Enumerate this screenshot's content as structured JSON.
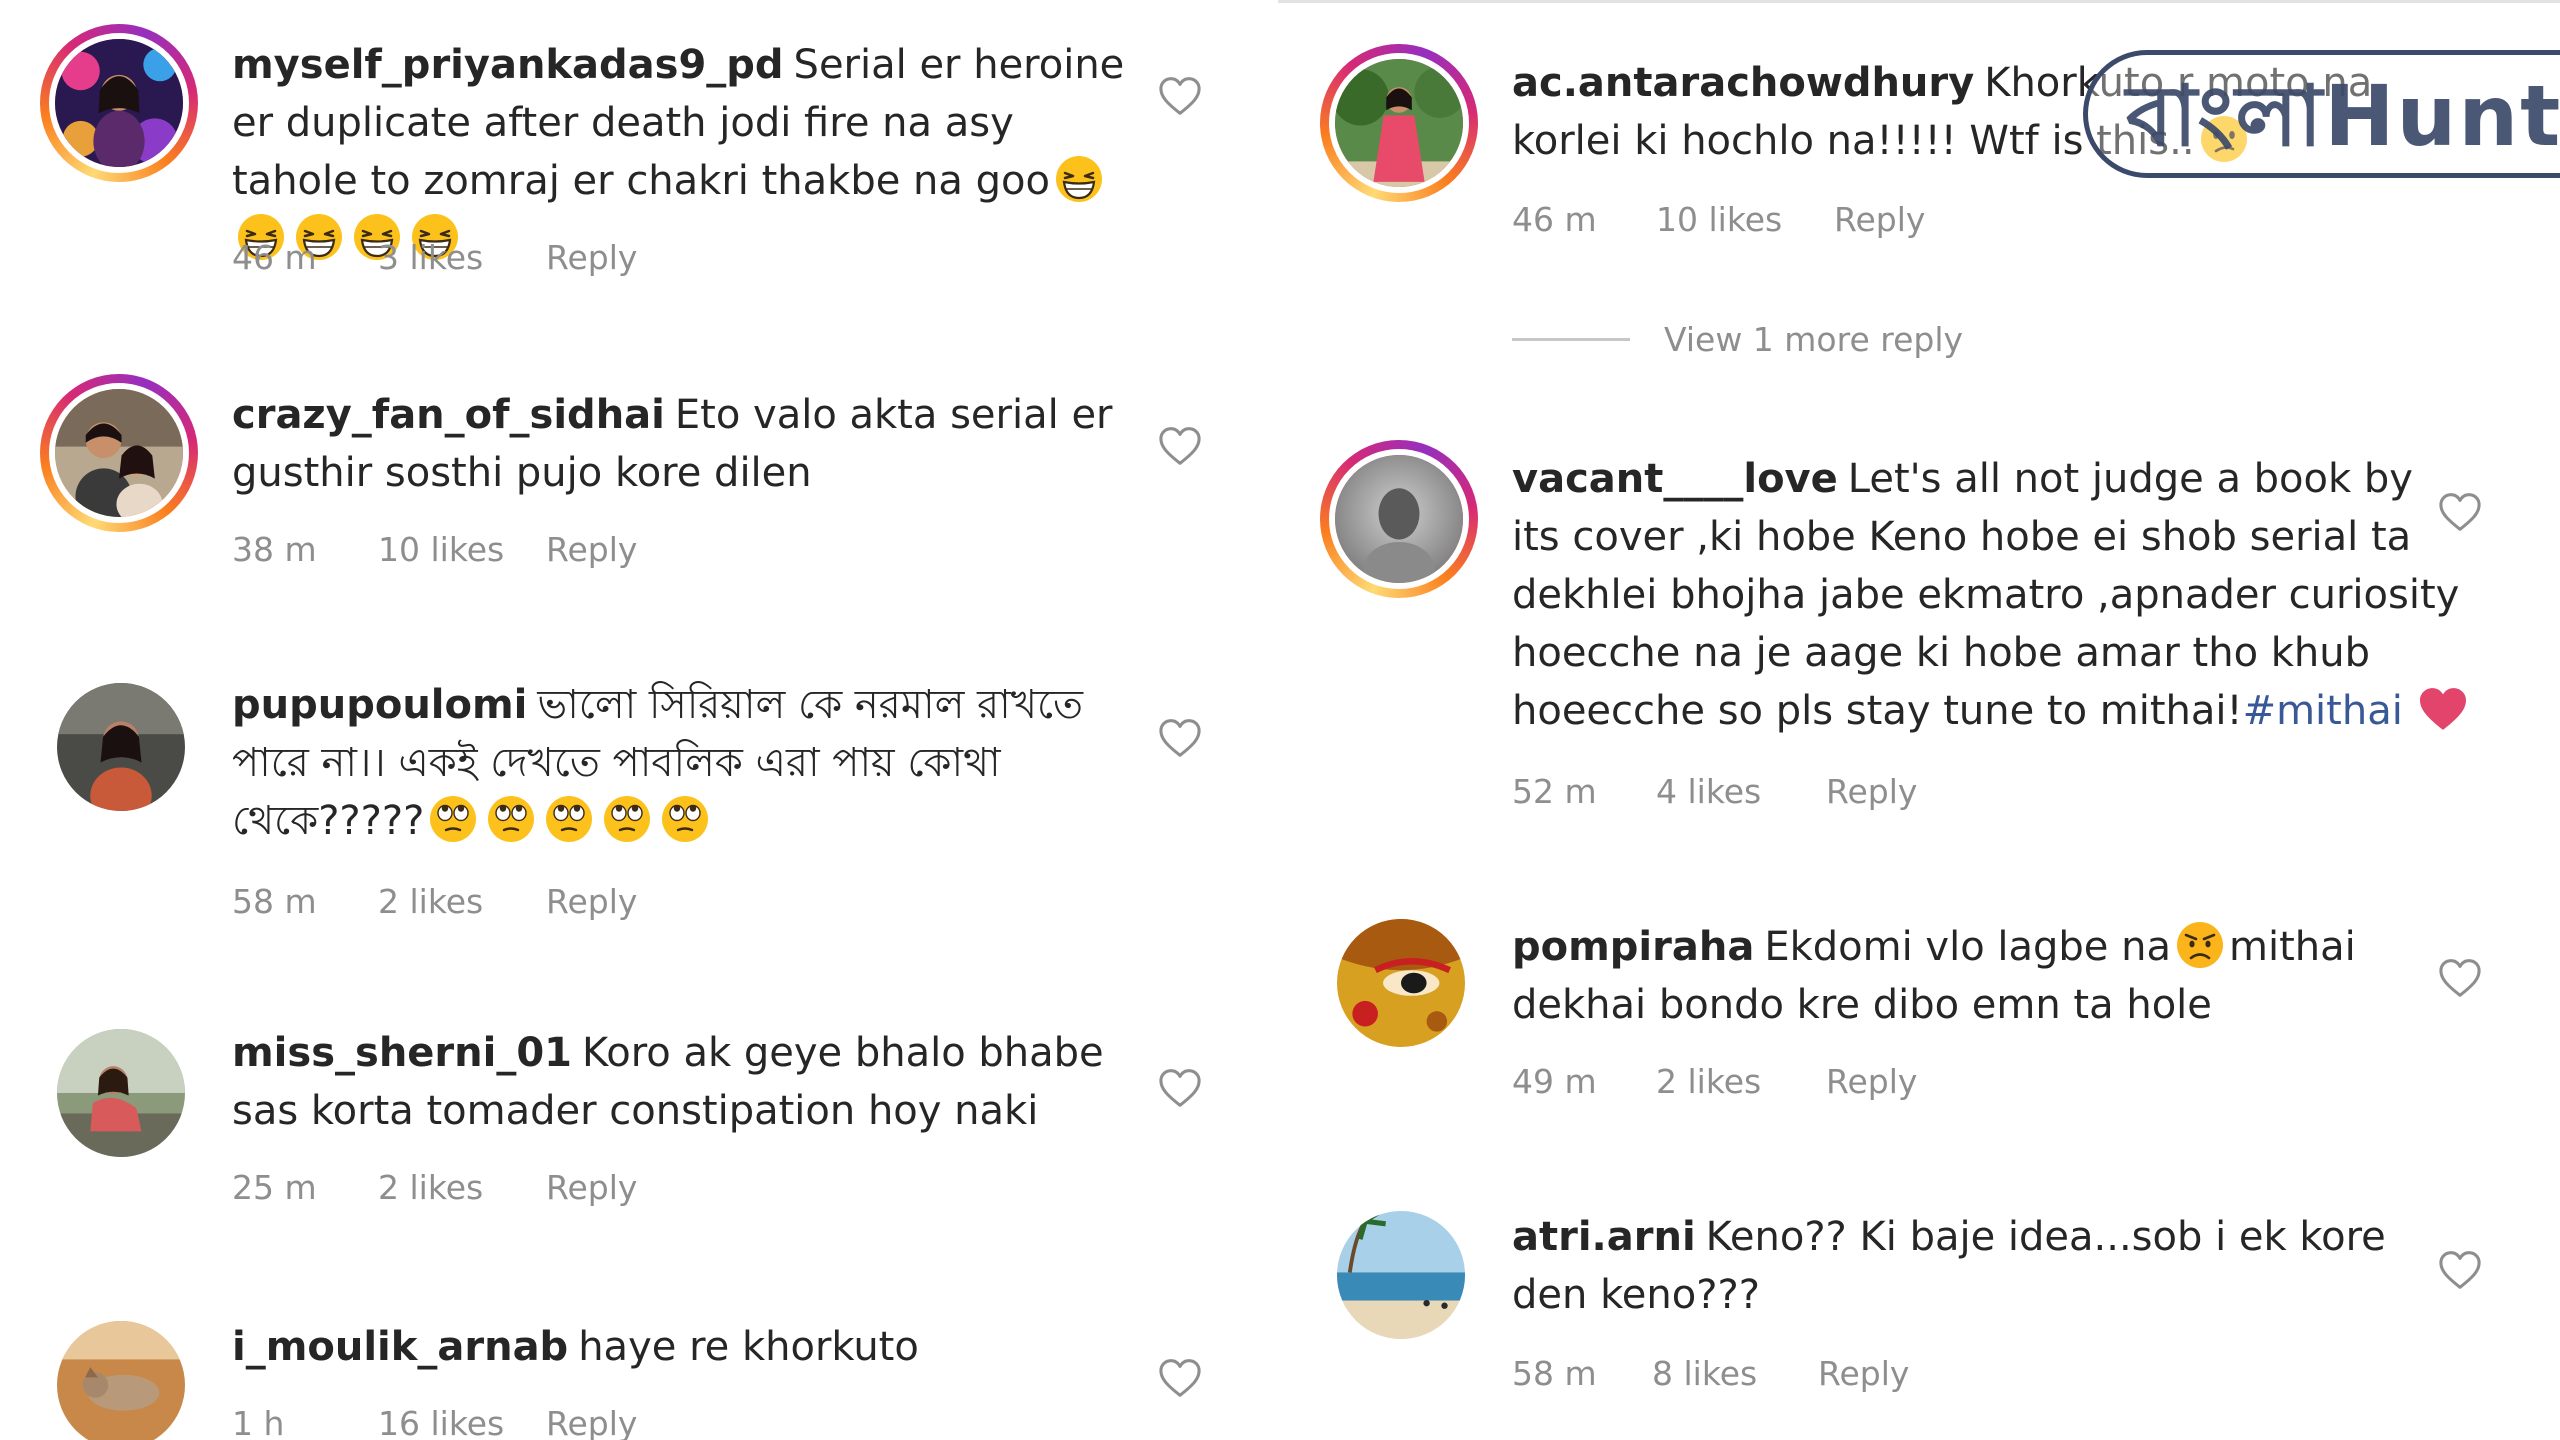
{
  "left_comments": [
    {
      "username": "myself_priyankadas9_pd",
      "text": "Serial er heroine er duplicate after death jodi fire na asy tahole to zomraj er chakri thakbe na goo",
      "emojis": [
        "grinning-squint-face",
        "grinning-squint-face",
        "grinning-squint-face",
        "grinning-squint-face",
        "grinning-squint-face"
      ],
      "time": "46 m",
      "likes": "3 likes",
      "reply": "Reply",
      "avatar_story_ring": true
    },
    {
      "username": "crazy_fan_of_sidhai",
      "text": "Eto valo akta serial er gusthir sosthi pujo kore dilen",
      "emojis": [],
      "time": "38 m",
      "likes": "10 likes",
      "reply": "Reply",
      "avatar_story_ring": true
    },
    {
      "username": "pupupoulomi",
      "text": "ভালো সিরিয়াল কে নরমাল রাখতে পারে না।। একই দেখতে পাবলিক এরা পায় কোথা থেকে?????",
      "emojis": [
        "eye-roll-face",
        "eye-roll-face",
        "eye-roll-face",
        "eye-roll-face",
        "eye-roll-face"
      ],
      "time": "58 m",
      "likes": "2 likes",
      "reply": "Reply",
      "avatar_story_ring": false
    },
    {
      "username": "miss_sherni_01",
      "text": "Koro ak geye bhalo bhabe sas korta tomader constipation hoy naki",
      "emojis": [],
      "time": "25 m",
      "likes": "2 likes",
      "reply": "Reply",
      "avatar_story_ring": false
    },
    {
      "username": "i_moulik_arnab",
      "text": "haye re khorkuto",
      "emojis": [],
      "time": "1 h",
      "likes": "16 likes",
      "reply": "Reply",
      "avatar_story_ring": false
    }
  ],
  "right_comments": [
    {
      "username": "ac.antarachowdhury",
      "text": "Khorkuto r moto na korlei ki hochlo na!!!!! Wtf is this..",
      "emojis": [
        "confused-face"
      ],
      "time": "46 m",
      "likes": "10 likes",
      "reply": "Reply",
      "avatar_story_ring": true
    },
    {
      "username": "vacant____love",
      "text": "Let's all not judge a book by its cover ,ki hobe Keno hobe ei shob serial ta dekhlei bhojha jabe ekmatro ,apnader curiosity hoecche na je aage ki hobe amar tho khub hoeecche so pls stay tune to mithai!",
      "hashtag": "#mithai",
      "emojis": [
        "pink-heart"
      ],
      "time": "52 m",
      "likes": "4 likes",
      "reply": "Reply",
      "avatar_story_ring": true
    },
    {
      "username": "pompiraha",
      "text_before": "Ekdomi vlo lagbe na",
      "text_after": "mithai dekhai bondo kre dibo emn  ta hole",
      "emojis": [
        "frowning-face"
      ],
      "time": "49 m",
      "likes": "2 likes",
      "reply": "Reply",
      "avatar_story_ring": false
    },
    {
      "username": "atri.arni",
      "text": "Keno?? Ki baje idea...sob i ek kore den keno???",
      "emojis": [],
      "time": "58 m",
      "likes": "8 likes",
      "reply": "Reply",
      "avatar_story_ring": false
    }
  ],
  "view_replies": "View 1 more reply",
  "watermark": "বাংলাHunt",
  "colors": {
    "text": "#262626",
    "meta": "#8e8e8e",
    "hashtag": "#385898",
    "heart_outline": "#8e8e8e",
    "pink_heart": "#e2446c"
  }
}
